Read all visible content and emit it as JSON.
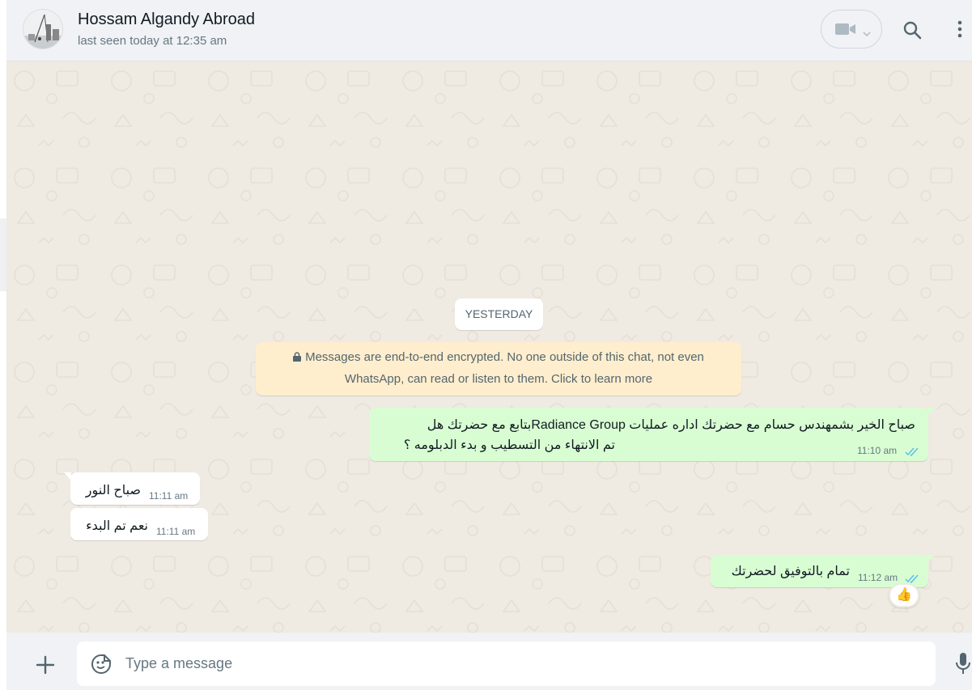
{
  "header": {
    "contact_name": "Hossam Algandy Abroad",
    "last_seen": "last seen today at 12:35 am"
  },
  "chat": {
    "date_divider": "YESTERDAY",
    "encryption_notice": {
      "line1": "Messages are end-to-end encrypted. No one outside of this chat, not even",
      "line2": "WhatsApp, can read or listen to them. Click to learn more"
    },
    "messages": [
      {
        "direction": "outgoing",
        "lines": [
          "صباح الخير بشمهندس حسام مع  حضرتك اداره عمليات Radiance Groupبتابع مع حضرتك هل",
          "تم الانتهاء من التسطيب و بدء الدبلومه ؟"
        ],
        "time": "11:10 am",
        "status": "read"
      },
      {
        "direction": "incoming",
        "text": "صباح النور",
        "time": "11:11 am"
      },
      {
        "direction": "incoming",
        "text": "نعم تم البدء",
        "time": "11:11 am"
      },
      {
        "direction": "outgoing",
        "text": "تمام بالتوفيق لحضرتك",
        "time": "11:12 am",
        "status": "read",
        "reaction": "👍"
      }
    ]
  },
  "composer": {
    "placeholder": "Type a message",
    "value": ""
  },
  "colors": {
    "header_bg": "#f0f2f5",
    "chat_bg": "#efeae2",
    "outgoing_bubble": "#d9fdd3",
    "incoming_bubble": "#ffffff",
    "notice_bg": "#ffeecd",
    "read_ticks": "#53bdeb",
    "icon_gray": "#54656f"
  },
  "icons": [
    "avatar",
    "video-call-icon",
    "chevron-down-icon",
    "search-icon",
    "menu-icon",
    "lock-icon",
    "double-check-icon",
    "plus-icon",
    "emoji-icon",
    "mic-icon"
  ]
}
